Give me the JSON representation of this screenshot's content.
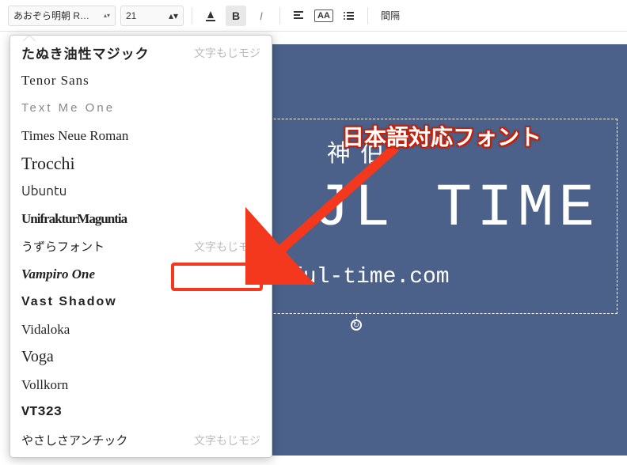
{
  "toolbar": {
    "font_name": "あおぞら明朝 R…",
    "font_size": "21",
    "bold": "B",
    "italic": "I",
    "case": "AA",
    "spacing": "間隔"
  },
  "canvas": {
    "line1": "神  伯",
    "line2": "JL TIME",
    "line3": "seful-time.com"
  },
  "callout": "日本語対応フォント",
  "fonts": [
    {
      "cls": "tanuki",
      "name": "たぬき油性マジック",
      "sample": "文字もじモジ"
    },
    {
      "cls": "tenor",
      "name": "Tenor Sans",
      "sample": ""
    },
    {
      "cls": "textme",
      "name": "Text Me One",
      "sample": ""
    },
    {
      "cls": "times",
      "name": "Times Neue Roman",
      "sample": ""
    },
    {
      "cls": "trocchi",
      "name": "Trocchi",
      "sample": ""
    },
    {
      "cls": "ubuntu",
      "name": "Ubuntu",
      "sample": ""
    },
    {
      "cls": "unifraktur",
      "name": "UnifrakturMaguntia",
      "sample": ""
    },
    {
      "cls": "uzura",
      "name": "うずらフォント",
      "sample": "文字もじモジ"
    },
    {
      "cls": "vampiro",
      "name": "Vampiro One",
      "sample": ""
    },
    {
      "cls": "vast",
      "name": "Vast Shadow",
      "sample": ""
    },
    {
      "cls": "vidaloka",
      "name": "Vidaloka",
      "sample": ""
    },
    {
      "cls": "voga",
      "name": "Voga",
      "sample": ""
    },
    {
      "cls": "vollkorn",
      "name": "Vollkorn",
      "sample": ""
    },
    {
      "cls": "vt323",
      "name": "VT323",
      "sample": ""
    },
    {
      "cls": "yasashisa",
      "name": "やさしさアンチック",
      "sample": "文字もじモジ"
    }
  ]
}
